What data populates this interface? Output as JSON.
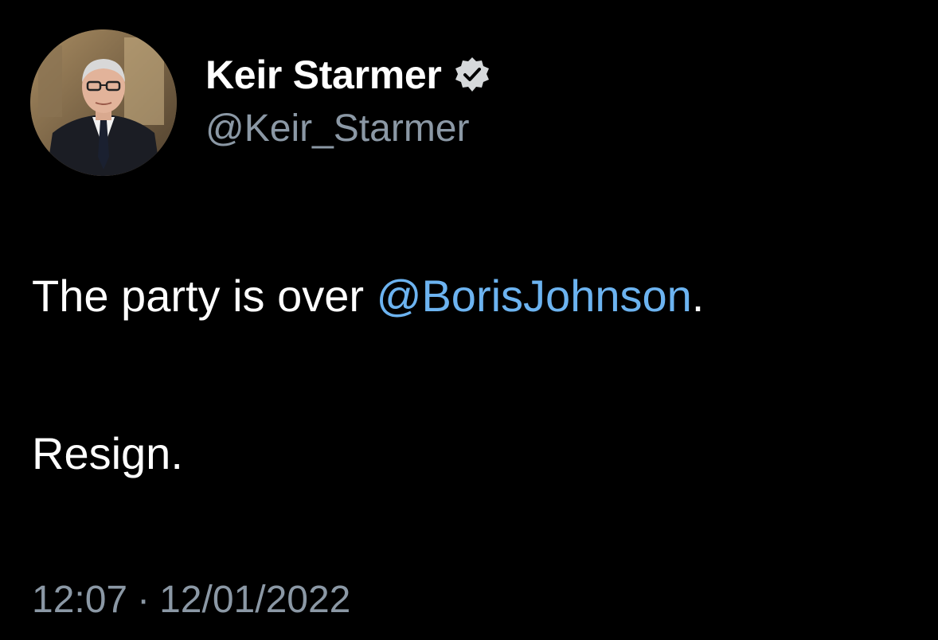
{
  "author": {
    "display_name": "Keir Starmer",
    "handle": "@Keir_Starmer",
    "verified_icon": "verified-badge-icon",
    "avatar": "profile-photo"
  },
  "tweet": {
    "line1_prefix": "The party is over ",
    "mention": "@BorisJohnson",
    "line1_suffix": ".",
    "line2": "Resign."
  },
  "meta": {
    "time": "12:07",
    "separator": "·",
    "date": "12/01/2022"
  },
  "colors": {
    "background": "#000000",
    "text_primary": "#ffffff",
    "text_secondary": "#8b98a5",
    "mention": "#6cb3f0",
    "badge": "#d6d9db"
  }
}
